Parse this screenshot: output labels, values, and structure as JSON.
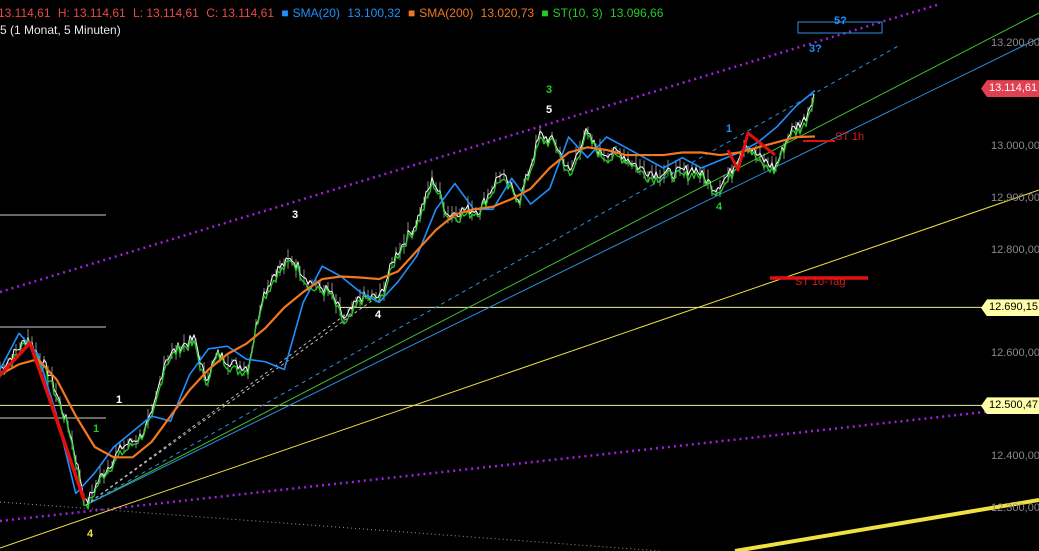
{
  "legend": {
    "last": "13.114,61",
    "high": "H: 13.114,61",
    "low": "L: 13.114,61",
    "close": "C: 13.114,61",
    "sma20_label": "SMA(20)",
    "sma20_value": "13.100,32",
    "sma200_label": "SMA(200)",
    "sma200_value": "13.020,73",
    "st_label": "ST(10, 3)",
    "st_value": "13.096,66",
    "subtitle": "5   (1 Monat, 5 Minuten)"
  },
  "colors": {
    "background": "#000000",
    "price": "#ffffff",
    "sma20": "#1e90ff",
    "sma200": "#f07820",
    "supertrend": "#22cc22",
    "legend_red": "#e84a4a",
    "channel": "#a020e0",
    "yellow": "#f0e040",
    "wave_red": "#e01010"
  },
  "chart_data": {
    "type": "line",
    "ylim": [
      12280,
      13240
    ],
    "yticks": [
      "13.200,00",
      "13.000,00",
      "12.900,00",
      "12.800,00",
      "12.600,00",
      "12.400,00",
      "12.300,00"
    ],
    "series": [
      {
        "name": "SMA(20)",
        "values": [
          12570,
          12640,
          12600,
          12480,
          12330,
          12370,
          12420,
          12450,
          12480,
          12470,
          12560,
          12610,
          12615,
          12590,
          12585,
          12570,
          12700,
          12770,
          12750,
          12720,
          12700,
          12740,
          12790,
          12880,
          12930,
          12880,
          12880,
          12940,
          12890,
          12920,
          13020,
          12980,
          13020,
          13000,
          12980,
          12960,
          12980,
          12960,
          12975,
          12990,
          13010,
          13040,
          13080,
          13110
        ]
      },
      {
        "name": "SMA(200)",
        "values": [
          12560,
          12580,
          12590,
          12550,
          12480,
          12420,
          12400,
          12400,
          12430,
          12480,
          12530,
          12570,
          12600,
          12620,
          12650,
          12690,
          12720,
          12745,
          12750,
          12748,
          12745,
          12760,
          12800,
          12840,
          12870,
          12880,
          12885,
          12900,
          12920,
          12960,
          12990,
          13000,
          12995,
          12985,
          12985,
          12985,
          12990,
          12990,
          12985,
          12990,
          13000,
          13010,
          13020,
          13021
        ]
      }
    ],
    "levels": [
      {
        "label": "12.690,15",
        "value": 12690.15
      },
      {
        "label": "12.500,47",
        "value": 12500.47
      }
    ],
    "last_price": {
      "label": "13.114,61",
      "value": 13114.61
    },
    "annotations": [
      {
        "text": "5?",
        "color": "#1e90ff"
      },
      {
        "text": "3?",
        "color": "#1e90ff"
      },
      {
        "text": "3",
        "color": "#22cc22"
      },
      {
        "text": "5",
        "color": "#ffffff"
      },
      {
        "text": "3",
        "color": "#ffffff"
      },
      {
        "text": "4",
        "color": "#ffffff"
      },
      {
        "text": "1",
        "color": "#ffffff"
      },
      {
        "text": "1",
        "color": "#22cc22"
      },
      {
        "text": "4",
        "color": "#f0e040"
      },
      {
        "text": "1",
        "color": "#1e90ff"
      },
      {
        "text": "4",
        "color": "#22cc22"
      },
      {
        "text": "ST 1h",
        "color": "#e01a1a"
      },
      {
        "text": "ST 10-Tag",
        "color": "#e01a1a"
      }
    ]
  }
}
